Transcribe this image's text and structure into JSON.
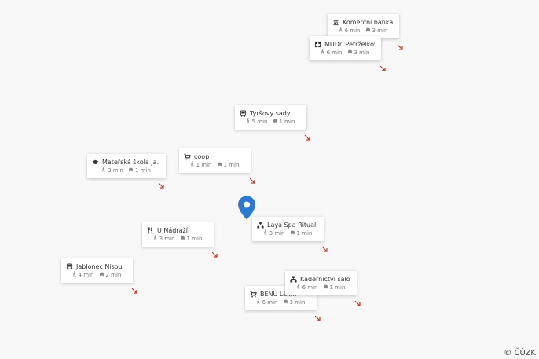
{
  "colors": {
    "pin": "#2a7ad3",
    "arrow": "#c0392b",
    "icon": "#333333",
    "meta": "#888888"
  },
  "map": {
    "pin": {
      "icon": "location-pin-icon"
    },
    "attribution": "© ČÚZK"
  },
  "pois": [
    {
      "name": "Komerční banka",
      "icon": "bank-icon",
      "walk": "6 min",
      "drive": "3 min"
    },
    {
      "name": "MUDr. Petrželkov...",
      "icon": "medical-cross-icon",
      "walk": "6 min",
      "drive": "3 min"
    },
    {
      "name": "Tyršovy sady",
      "icon": "bus-icon",
      "walk": "5 min",
      "drive": "1 min"
    },
    {
      "name": "Mateřská škola Ja...",
      "icon": "graduation-cap-icon",
      "walk": "3 min",
      "drive": "1 min"
    },
    {
      "name": "coop",
      "icon": "shopping-cart-icon",
      "walk": "1 min",
      "drive": "1 min"
    },
    {
      "name": "Laya Spa Ritual - J...",
      "icon": "services-icon",
      "walk": "3 min",
      "drive": "1 min"
    },
    {
      "name": "U Nádraží",
      "icon": "restaurant-icon",
      "walk": "3 min",
      "drive": "1 min"
    },
    {
      "name": "Jablonec Nisou",
      "icon": "bus-icon",
      "walk": "4 min",
      "drive": "2 min"
    },
    {
      "name": "Kadeřnictví salon...",
      "icon": "services-icon",
      "walk": "6 min",
      "drive": "1 min"
    },
    {
      "name": "BENU Lék...",
      "icon": "shopping-cart-icon",
      "walk": "6 min",
      "drive": "3 min"
    }
  ]
}
